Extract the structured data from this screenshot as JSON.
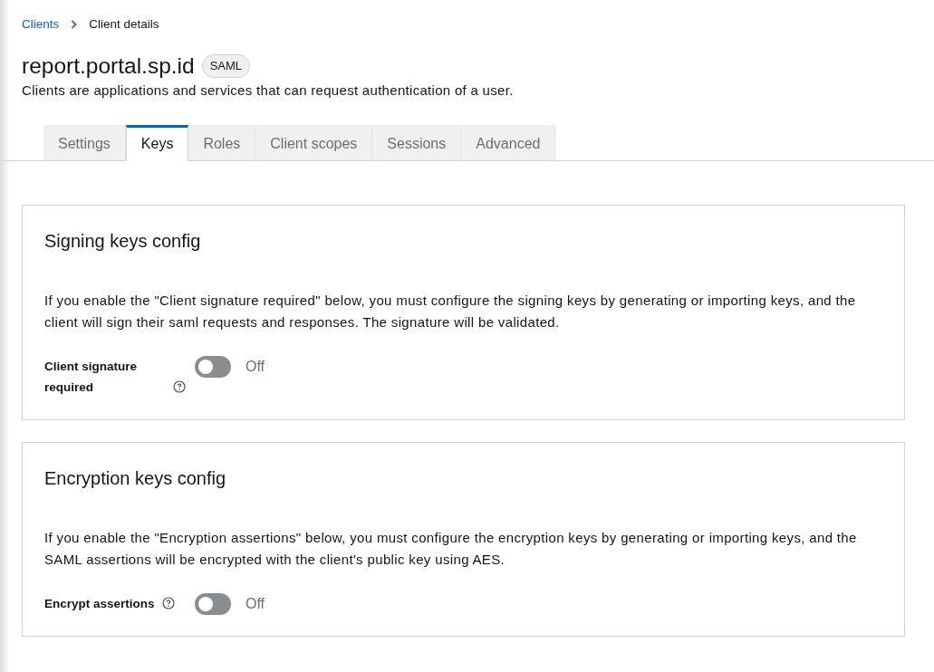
{
  "breadcrumb": [
    {
      "label": "Clients",
      "kind": "link"
    },
    {
      "label": "Client details",
      "kind": "current"
    }
  ],
  "header": {
    "title": "report.portal.sp.id",
    "badge": "SAML",
    "description": "Clients are applications and services that can request authentication of a user."
  },
  "tabs": [
    {
      "label": "Settings",
      "selected": false
    },
    {
      "label": "Keys",
      "selected": true
    },
    {
      "label": "Roles",
      "selected": false
    },
    {
      "label": "Client scopes",
      "selected": false
    },
    {
      "label": "Sessions",
      "selected": false
    },
    {
      "label": "Advanced",
      "selected": false
    }
  ],
  "sections": [
    {
      "title": "Signing keys config",
      "description": "If you enable the \"Client signature required\" below, you must configure the signing keys by generating or importing keys, and the client will sign their saml requests and responses. The signature will be validated.",
      "field": {
        "label": "Client signature required",
        "on": false,
        "state_text": "Off"
      }
    },
    {
      "title": "Encryption keys config",
      "description": "If you enable the \"Encryption assertions\" below, you must configure the encryption keys by generating or importing keys, and the SAML assertions will be encrypted with the client's public key using AES.",
      "field": {
        "label": "Encrypt assertions",
        "on": false,
        "state_text": "Off"
      }
    }
  ]
}
